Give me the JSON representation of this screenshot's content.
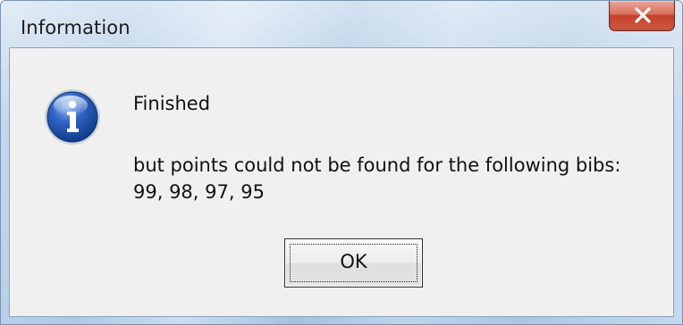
{
  "window": {
    "title": "Information"
  },
  "dialog": {
    "icon": "info-icon",
    "heading": "Finished",
    "message_line1": "but points could not be found for the following bibs:",
    "message_line2": "99, 98, 97, 95",
    "ok_label": "OK"
  },
  "colors": {
    "close_button": "#c5402a",
    "info_icon": "#1f4fa8",
    "content_background": "#f0f0f0"
  }
}
